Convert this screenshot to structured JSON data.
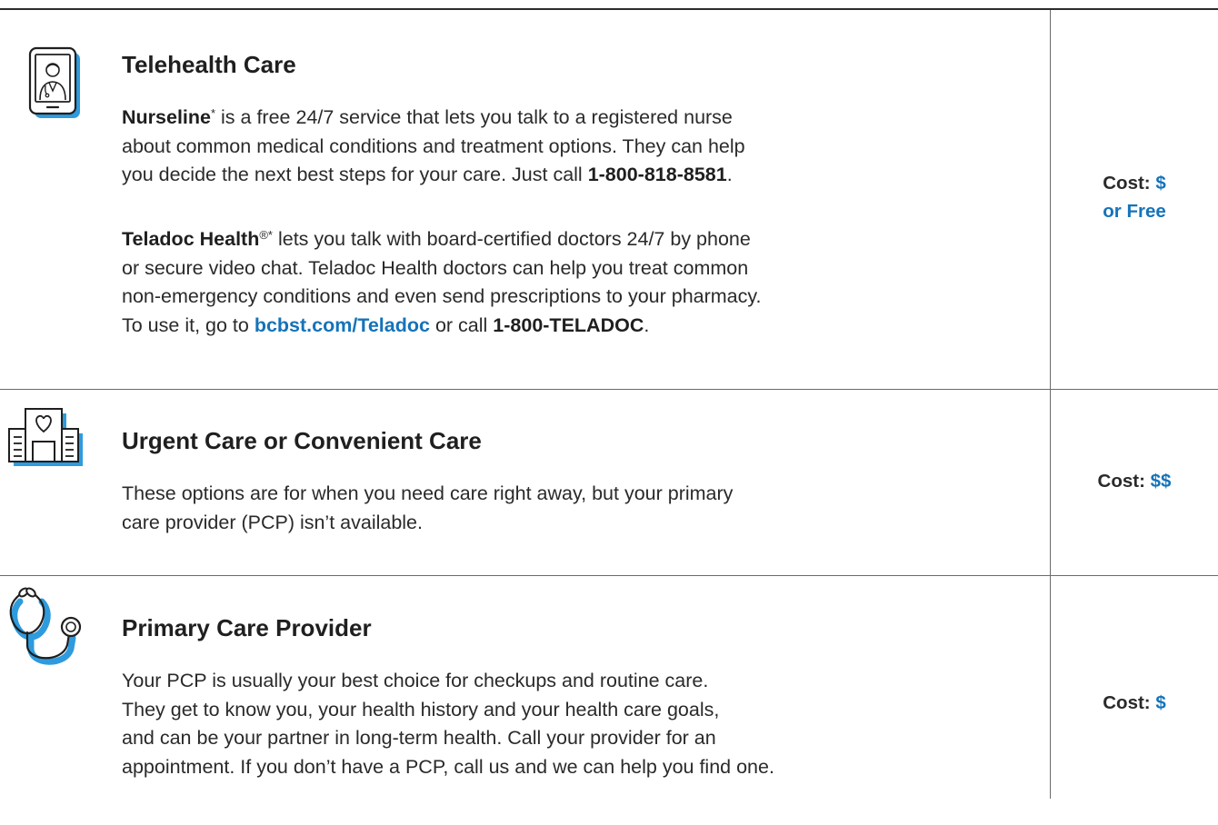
{
  "colors": {
    "accent_blue": "#1573b9",
    "icon_shadow_blue": "#2e9bde",
    "rule_dark": "#2b2b2b",
    "rule_grey": "#6b6b6b"
  },
  "sections": [
    {
      "icon": "phone-doctor-icon",
      "title": "Telehealth Care",
      "nurseline": {
        "name": "Nurseline",
        "mark": "*",
        "line1_rest": " is a free 24/7 service that lets you talk to a registered nurse",
        "line2": "about common medical conditions and treatment options. They can help",
        "line3_pre": "you decide the next best steps for your care. Just call ",
        "phone": "1-800-818-8581",
        "line3_end": "."
      },
      "teladoc": {
        "name": "Teladoc Health",
        "mark": "®*",
        "line1_rest": " lets you talk with board-certified doctors 24/7 by phone",
        "line2": "or secure video chat. Teladoc Health doctors can help you treat common",
        "line3": "non-emergency conditions and even send prescriptions to your pharmacy.",
        "line4_pre": "To use it, go to ",
        "link": "bcbst.com/Teladoc",
        "line4_mid": " or call ",
        "phone": "1-800-TELADOC",
        "line4_end": "."
      },
      "cost_label": "Cost:",
      "cost_value_1": "$",
      "cost_value_2": "or Free"
    },
    {
      "icon": "hospital-building-icon",
      "title": "Urgent Care or Convenient Care",
      "body": [
        "These options are for when you need care right away, but your primary",
        "care provider (PCP) isn’t available."
      ],
      "cost_label": "Cost:",
      "cost_value": "$$"
    },
    {
      "icon": "stethoscope-icon",
      "title": "Primary Care Provider",
      "body": [
        "Your PCP is usually your best choice for checkups and routine care.",
        "They get to know you, your health history and your health care goals,",
        "and can be your partner in long-term health. Call your provider for an",
        "appointment. If you don’t have a PCP, call us and we can help you find one."
      ],
      "cost_label": "Cost:",
      "cost_value": "$"
    }
  ]
}
